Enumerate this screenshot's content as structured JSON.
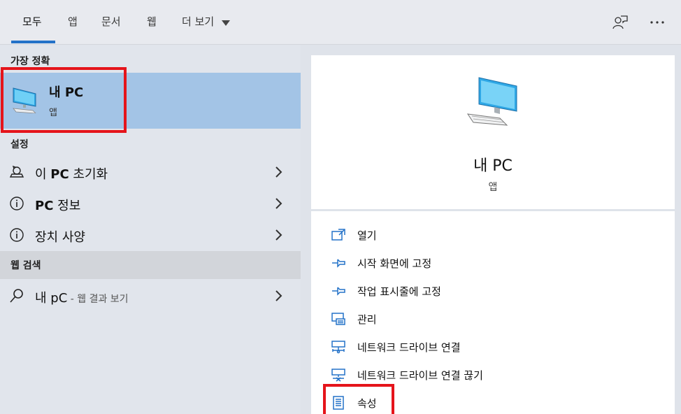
{
  "tabs": {
    "all": "모두",
    "apps": "앱",
    "documents": "문서",
    "web": "웹",
    "more": "더 보기"
  },
  "toolbar": {
    "feedback_icon": "feedback-person-icon",
    "more_icon": "ellipsis-icon"
  },
  "best_match": {
    "header": "가장 정확",
    "title": "내 PC",
    "subtitle": "앱"
  },
  "settings": {
    "header": "설정",
    "items": [
      {
        "prefix": "이 ",
        "bold": "PC",
        "suffix": " 초기화",
        "icon": "reset-icon"
      },
      {
        "prefix": "",
        "bold": "PC",
        "suffix": " 정보",
        "icon": "info-icon"
      },
      {
        "prefix": "",
        "bold": "",
        "suffix": "장치 사양",
        "icon": "info-icon"
      }
    ]
  },
  "web_search": {
    "header": "웹 검색",
    "query": "내 pC",
    "suffix": " - 웹 결과 보기"
  },
  "detail": {
    "title": "내 PC",
    "subtitle": "앱",
    "actions": [
      {
        "label": "열기",
        "icon": "open-icon"
      },
      {
        "label": "시작 화면에 고정",
        "icon": "pin-icon"
      },
      {
        "label": "작업 표시줄에 고정",
        "icon": "pin-icon"
      },
      {
        "label": "관리",
        "icon": "manage-icon"
      },
      {
        "label": "네트워크 드라이브 연결",
        "icon": "network-drive-icon"
      },
      {
        "label": "네트워크 드라이브 연결 끊기",
        "icon": "network-drive-disconnect-icon"
      },
      {
        "label": "속성",
        "icon": "properties-icon"
      }
    ]
  },
  "colors": {
    "accent": "#2472c8",
    "highlight_box": "#e5141b",
    "selected_bg": "#a3c4e6"
  }
}
